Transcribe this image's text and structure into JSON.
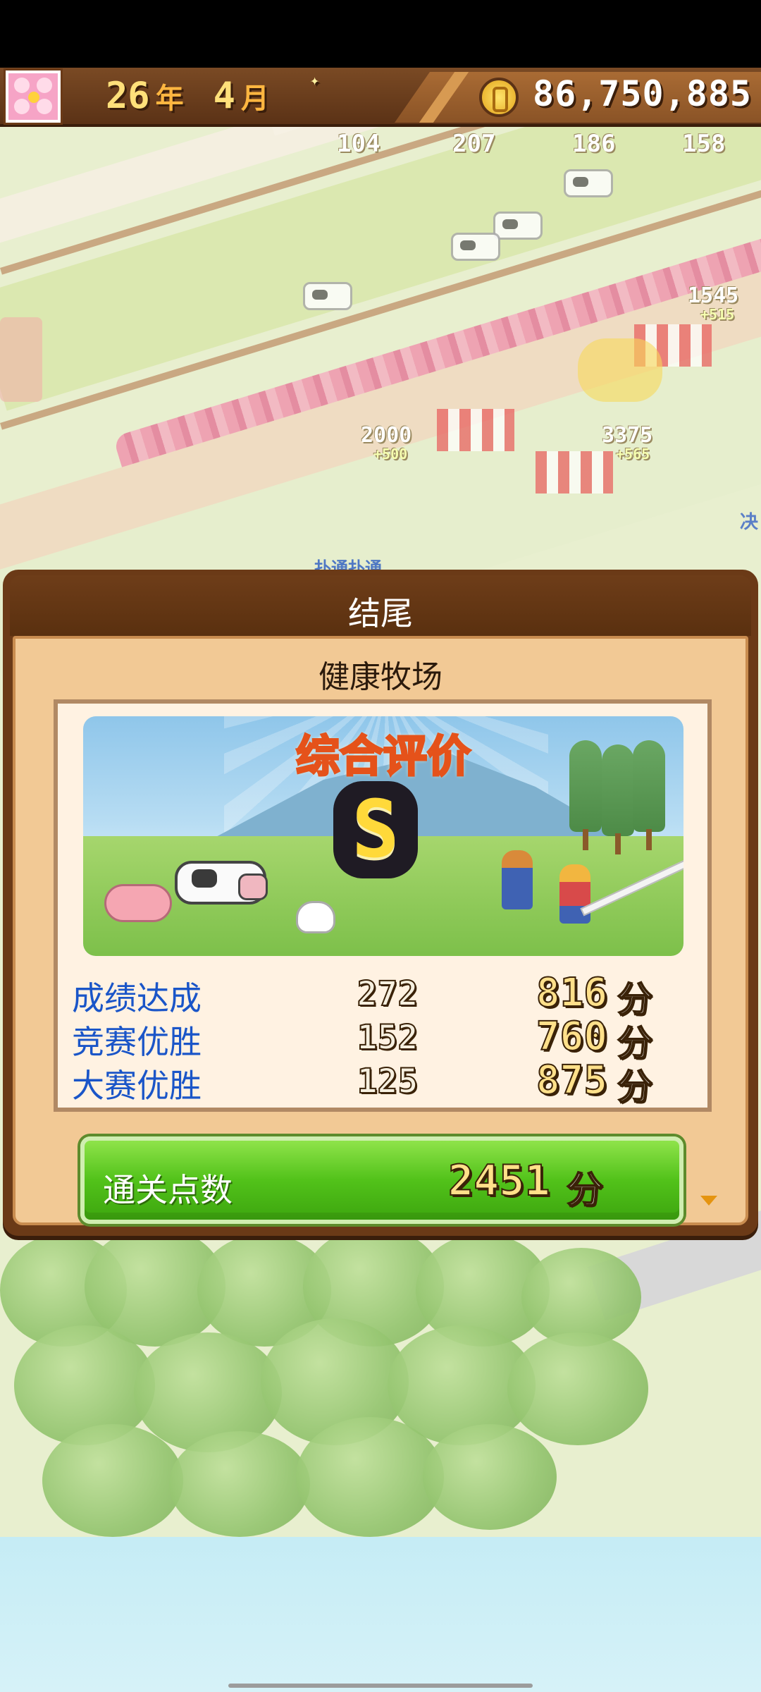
{
  "header": {
    "year_value": "26",
    "year_unit": "年",
    "month_value": "4",
    "month_unit": "月",
    "money": "86,750,885",
    "icons": {
      "avatar": "flower-avatar-icon",
      "coin": "coin-icon"
    }
  },
  "world": {
    "resource_counts": [
      "104",
      "207",
      "186",
      "158"
    ],
    "floating_values": [
      "1545",
      "+515",
      "2000",
      "+500",
      "3375",
      "+565"
    ],
    "partial_labels": [
      "决",
      "扑通扑通"
    ]
  },
  "dialog": {
    "title": "结尾",
    "subtitle": "健康牧场",
    "evaluation_title": "综合评价",
    "grade": "S",
    "stats": [
      {
        "label": "成绩达成",
        "count": "272",
        "points": "816",
        "unit": "分"
      },
      {
        "label": "竞赛优胜",
        "count": "152",
        "points": "760",
        "unit": "分"
      },
      {
        "label": "大赛优胜",
        "count": "125",
        "points": "875",
        "unit": "分"
      }
    ],
    "total": {
      "label": "通关点数",
      "value": "2451",
      "unit": "分"
    }
  },
  "colors": {
    "frame_brown": "#6b3a17",
    "panel_tan": "#f2c995",
    "label_blue": "#1a55c8",
    "total_green": "#52c21a",
    "eval_orange": "#e5521a"
  }
}
